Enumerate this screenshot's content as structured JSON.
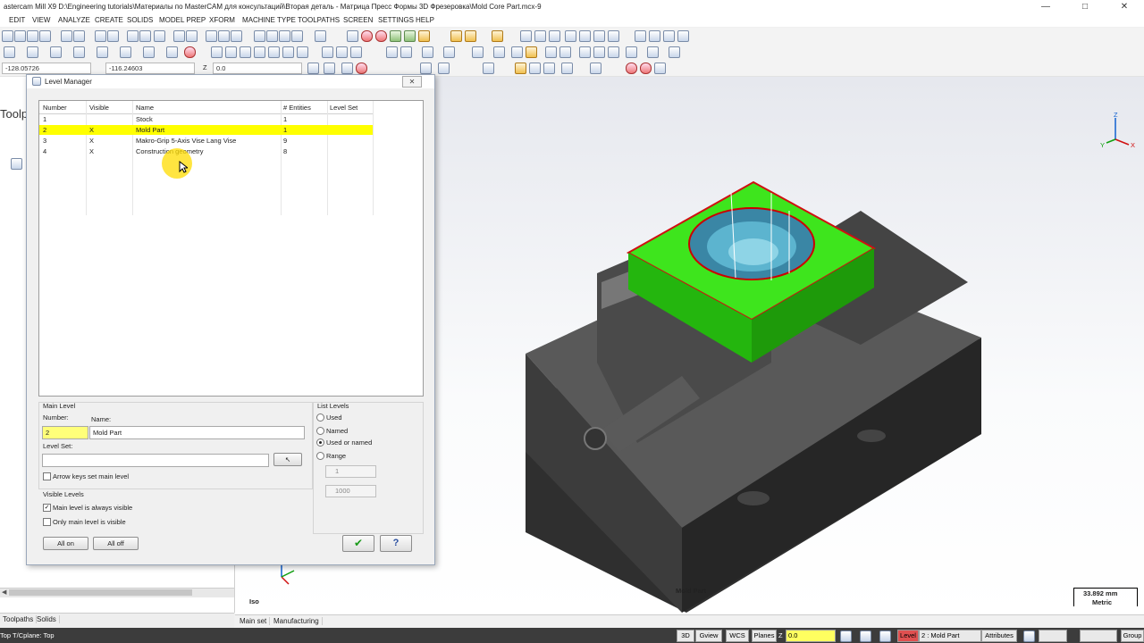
{
  "window": {
    "title": "astercam Mill X9  D:\\Engineering tutorials\\Материалы по MasterCAM для консультаций\\Вторая деталь - Матрица Пресс Формы 3D Фрезеровка\\Mold Core Part.mcx-9",
    "minimize": "—",
    "maximize": "□",
    "close": "✕"
  },
  "menu": [
    "EDIT",
    "VIEW",
    "ANALYZE",
    "CREATE",
    "SOLIDS",
    "MODEL PREP",
    "XFORM",
    "MACHINE TYPE",
    "TOOLPATHS",
    "SCREEN",
    "SETTINGS",
    "HELP"
  ],
  "coords": {
    "x": "-128.05726",
    "y": "-116.24603",
    "z_label": "Z",
    "z": "0.0"
  },
  "left_panel": {
    "title_fragment": "Toolp",
    "scroll": "◀"
  },
  "level_manager": {
    "title": "Level Manager",
    "close": "✕",
    "columns": [
      "Number",
      "Visible",
      "Name",
      "# Entities",
      "Level Set"
    ],
    "rows": [
      {
        "number": "1",
        "visible": "",
        "name": "Stock",
        "entities": "1",
        "set": ""
      },
      {
        "number": "2",
        "visible": "X",
        "name": "Mold Part",
        "entities": "1",
        "set": ""
      },
      {
        "number": "3",
        "visible": "X",
        "name": "Makro-Grip 5-Axis Vise Lang Vise",
        "entities": "9",
        "set": ""
      },
      {
        "number": "4",
        "visible": "X",
        "name": "Construction geometry",
        "entities": "8",
        "set": ""
      }
    ],
    "main_level": {
      "group_label": "Main Level",
      "number_label": "Number:",
      "number_value": "2",
      "name_label": "Name:",
      "name_value": "Mold Part",
      "level_set_label": "Level Set:",
      "level_set_value": "",
      "pick_icon": "↖",
      "arrow_keys_label": "Arrow keys set main level"
    },
    "visible_levels": {
      "group_label": "Visible Levels",
      "main_always_label": "Main level is always visible",
      "only_main_label": "Only main level is visible",
      "check": "✓"
    },
    "buttons": {
      "all_on": "All on",
      "all_off": "All off",
      "ok": "✔",
      "help": "?"
    },
    "list_levels": {
      "group_label": "List Levels",
      "options": [
        "Used",
        "Named",
        "Used or named",
        "Range"
      ],
      "selected": "Used or named",
      "range_from": "1",
      "range_to": "1000"
    }
  },
  "viewport": {
    "level_label": "Mold Part",
    "view_name": "Iso",
    "scale_value": "33.892 mm",
    "scale_units": "Metric",
    "axis_x": "X",
    "axis_y": "Y",
    "axis_z": "Z"
  },
  "tabs_left": [
    "Toolpaths",
    "Solids"
  ],
  "tabs_bottom": [
    "Main set",
    "Manufacturing"
  ],
  "status": {
    "plane_info": "Top  T/Cplane: Top",
    "btn_3d": "3D",
    "gview": "Gview",
    "wcs": "WCS",
    "planes": "Planes",
    "z_label": "Z",
    "z_value": "0.0",
    "level_label": "Level",
    "level_value": "2 : Mold Part",
    "attributes": "Attributes",
    "groups": "Group"
  },
  "colors": {
    "highlight": "#ffff00",
    "part_green": "#2ecc10",
    "vise_dark": "#3b3b3b",
    "status_bg": "#3c3c3c"
  }
}
